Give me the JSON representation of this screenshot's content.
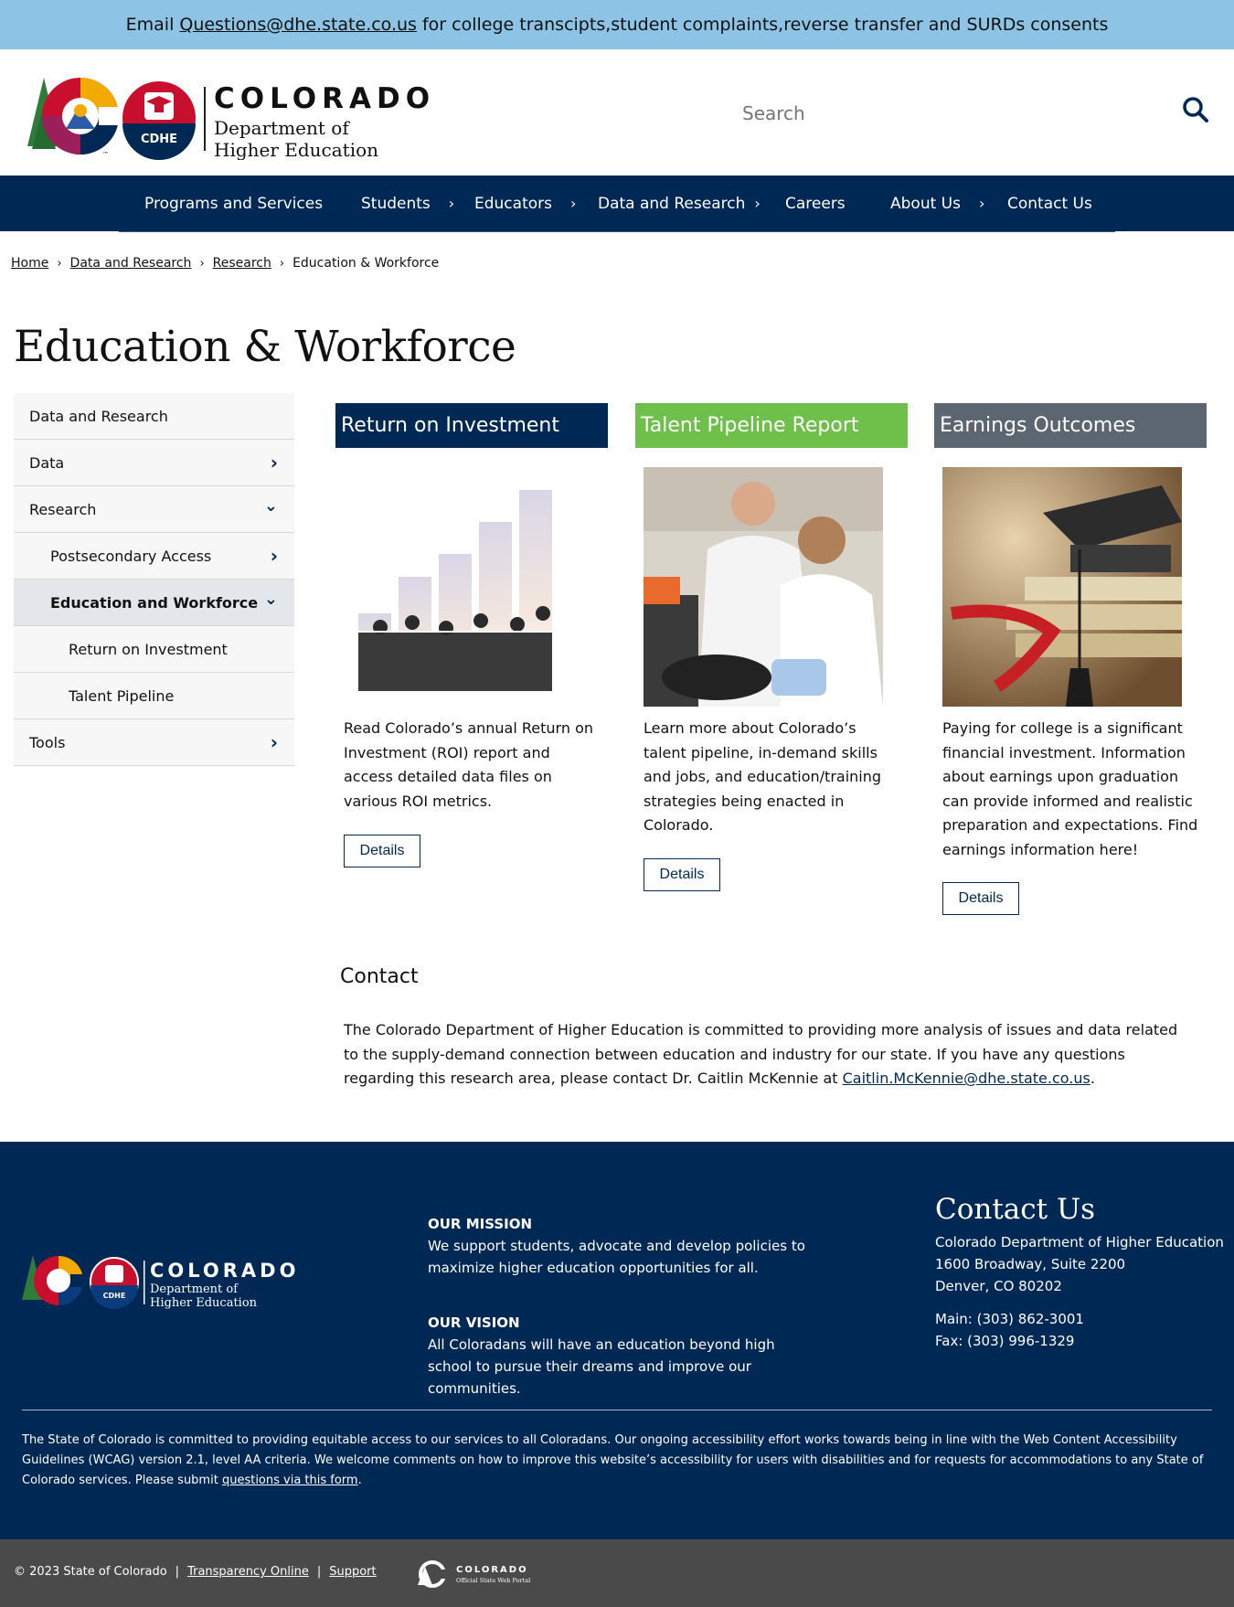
{
  "banner": {
    "prefix": "Email",
    "email": "Questions@dhe.state.co.us",
    "suffix": "for college transcipts,student complaints,reverse transfer and SURDs consents"
  },
  "logo": {
    "wordmark": "COLORADO",
    "line1": "Department of",
    "line2": "Higher Education",
    "seal_text": "CDHE",
    "tm": "™"
  },
  "search": {
    "placeholder": "Search"
  },
  "nav": {
    "items": [
      {
        "label": "Programs and Services",
        "has_submenu": false
      },
      {
        "label": "Students",
        "has_submenu": true
      },
      {
        "label": "Educators",
        "has_submenu": true
      },
      {
        "label": "Data and Research",
        "has_submenu": true
      },
      {
        "label": "Careers",
        "has_submenu": false
      },
      {
        "label": "About Us",
        "has_submenu": true
      },
      {
        "label": "Contact Us",
        "has_submenu": false
      }
    ],
    "chevron": "›"
  },
  "breadcrumb": {
    "items": [
      "Home",
      "Data and Research",
      "Research",
      "Education & Workforce"
    ],
    "separator": "›"
  },
  "page": {
    "title": "Education & Workforce"
  },
  "sidebar": {
    "items": [
      {
        "label": "Data and Research",
        "chevron": ""
      },
      {
        "label": "Data",
        "chevron": "›"
      },
      {
        "label": "Research",
        "chevron": "⌄"
      },
      {
        "label": "Postsecondary Access",
        "chevron": "›"
      },
      {
        "label": "Education and Workforce",
        "chevron": "⌄"
      },
      {
        "label": "Return on Investment",
        "chevron": ""
      },
      {
        "label": "Talent Pipeline",
        "chevron": ""
      },
      {
        "label": "Tools",
        "chevron": "›"
      }
    ]
  },
  "cards": [
    {
      "title": "Return on Investment",
      "color": "#002855",
      "text": "Read Colorado’s annual Return on Investment (ROI) report and access detailed data files on various ROI metrics.",
      "button": "Details"
    },
    {
      "title": "Talent Pipeline Report",
      "color": "#6fc04b",
      "text": "Learn more about Colorado’s talent pipeline, in-demand skills and jobs, and education/training strategies being enacted in Colorado.",
      "button": "Details"
    },
    {
      "title": "Earnings Outcomes",
      "color": "#5b6670",
      "text": "Paying for college is a significant financial investment. Information about earnings upon graduation can provide informed and realistic preparation and expectations. Find earnings information here!",
      "button": "Details"
    }
  ],
  "contact": {
    "heading": "Contact",
    "text": "The Colorado Department of Higher Education is committed to providing more analysis of issues and data related to the supply-demand connection between education and industry for our state.  If you have any questions regarding this research area, please contact Dr. Caitlin McKennie at",
    "email": "Caitlin.McKennie@dhe.state.co.us",
    "end": "."
  },
  "footer": {
    "mission_head": "OUR MISSION",
    "mission_text": "We support students, advocate and develop policies to maximize higher education opportunities for all.",
    "vision_head": "OUR VISION",
    "vision_text": "All Coloradans will have an education beyond high school to pursue their dreams and improve our communities.",
    "contact_title": "Contact Us",
    "org": "Colorado Department of Higher Education",
    "address1": "1600 Broadway, Suite 2200",
    "address2": "Denver, CO 80202",
    "main": "Main: (303) 862-3001",
    "fax": "Fax: (303) 996-1329",
    "accessibility_text": "The State of Colorado is committed to providing equitable access to our services to all Coloradans. Our ongoing accessibility effort works towards being in line with the Web Content Accessibility Guidelines (WCAG) version 2.1, level AA criteria. We welcome comments on how to improve this website’s accessibility for users with disabilities and for requests for accommodations to any State of Colorado services. Please submit",
    "accessibility_link": "questions via this form",
    "accessibility_end": "."
  },
  "bottom": {
    "copyright": "© 2023 State of Colorado",
    "sep": "|",
    "transparency": "Transparency Online",
    "support": "Support",
    "portal_wordmark": "COLORADO",
    "portal_sub": "Official State Web Portal"
  },
  "colors": {
    "navy": "#002855",
    "banner": "#8dc3e5",
    "green": "#6fc04b",
    "slate": "#5b6670",
    "footer_bottom": "#4a4a4a"
  },
  "icons": [
    "search-icon",
    "chevron-right-icon",
    "chevron-down-icon"
  ]
}
